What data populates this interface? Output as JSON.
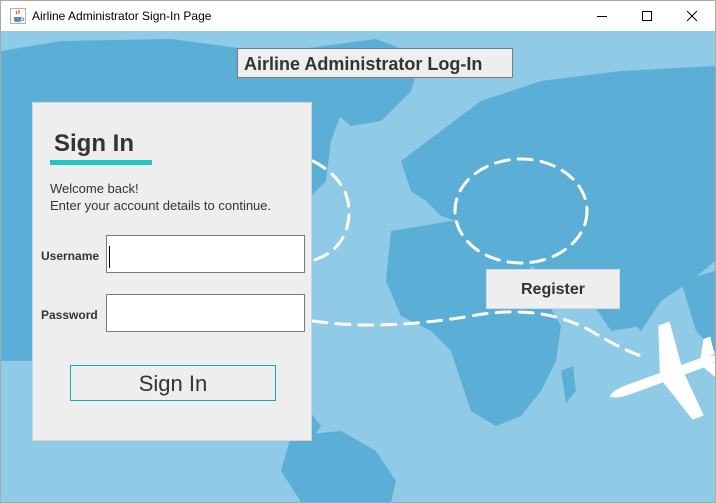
{
  "window": {
    "title": "Airline Administrator Sign-In Page",
    "controls": [
      "minimize",
      "maximize",
      "close"
    ]
  },
  "header": {
    "title": "Airline Administrator Log-In"
  },
  "signin_panel": {
    "title": "Sign In",
    "welcome_line1": "Welcome back!",
    "welcome_line2": "Enter your account details to continue.",
    "username_label": "Username",
    "username_value": "",
    "password_label": "Password",
    "password_value": "",
    "signin_button": "Sign In"
  },
  "register_button": "Register",
  "colors": {
    "background_sky": "#8fcbe6",
    "map_land": "#5baed6",
    "accent_teal": "#1fc6c6",
    "panel_bg": "#eeeeee",
    "text": "#333333"
  },
  "icons": {
    "app": "java-cup-icon",
    "plane": "airplane-icon"
  }
}
